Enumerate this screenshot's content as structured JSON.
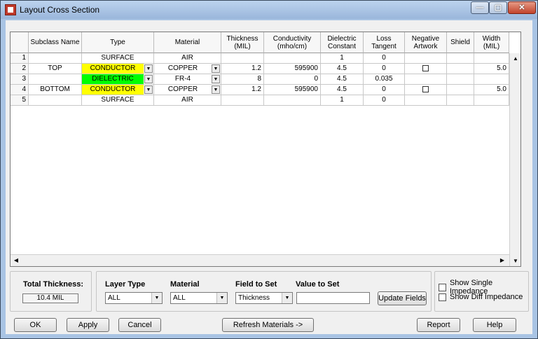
{
  "window": {
    "title": "Layout Cross Section",
    "min": "—",
    "max": "▢",
    "close": "✕"
  },
  "grid": {
    "headers": [
      "",
      "Subclass Name",
      "Type",
      "Material",
      "Thickness\n(MIL)",
      "Conductivity\n(mho/cm)",
      "Dielectric\nConstant",
      "Loss\nTangent",
      "Negative\nArtwork",
      "Shield",
      "Width\n(MIL)"
    ],
    "rows": [
      {
        "num": "1",
        "subclass": "",
        "type": "SURFACE",
        "type_color": "none",
        "material": "AIR",
        "material_dd": false,
        "thickness": "",
        "conductivity": "",
        "dielectric": "1",
        "loss": "0",
        "neg": false,
        "width": ""
      },
      {
        "num": "2",
        "subclass": "TOP",
        "type": "CONDUCTOR",
        "type_color": "#ffff00",
        "material": "COPPER",
        "material_dd": true,
        "thickness": "1.2",
        "conductivity": "595900",
        "dielectric": "4.5",
        "loss": "0",
        "neg": true,
        "width": "5.0"
      },
      {
        "num": "3",
        "subclass": "",
        "type": "DIELECTRIC",
        "type_color": "#00ff00",
        "material": "FR-4",
        "material_dd": true,
        "thickness": "8",
        "conductivity": "0",
        "dielectric": "4.5",
        "loss": "0.035",
        "neg": false,
        "width": ""
      },
      {
        "num": "4",
        "subclass": "BOTTOM",
        "type": "CONDUCTOR",
        "type_color": "#ffff00",
        "material": "COPPER",
        "material_dd": true,
        "thickness": "1.2",
        "conductivity": "595900",
        "dielectric": "4.5",
        "loss": "0",
        "neg": true,
        "width": "5.0"
      },
      {
        "num": "5",
        "subclass": "",
        "type": "SURFACE",
        "type_color": "none",
        "material": "AIR",
        "material_dd": false,
        "thickness": "",
        "conductivity": "",
        "dielectric": "1",
        "loss": "0",
        "neg": false,
        "width": ""
      }
    ]
  },
  "total_thickness": {
    "label": "Total Thickness:",
    "value": "10.4 MIL"
  },
  "field_set": {
    "layer_type_label": "Layer Type",
    "layer_type_value": "ALL",
    "material_label": "Material",
    "material_value": "ALL",
    "field_label": "Field to Set",
    "field_value": "Thickness",
    "value_label": "Value to Set",
    "value_value": "",
    "update_button": "Update Fields"
  },
  "impedance": {
    "single": "Show Single Impedance",
    "diff": "Show Diff Impedance"
  },
  "buttons": {
    "ok": "OK",
    "apply": "Apply",
    "cancel": "Cancel",
    "refresh": "Refresh Materials ->",
    "report": "Report",
    "help": "Help"
  },
  "colors": {
    "conductor": "#ffff00",
    "dielectric": "#00ff00",
    "titlebar": "#a9c4e4"
  },
  "icons": {
    "dropdown": "chevron-down-icon",
    "scroll_up": "scroll-up-icon",
    "scroll_down": "scroll-down-icon",
    "scroll_left": "scroll-left-icon",
    "scroll_right": "scroll-right-icon"
  }
}
